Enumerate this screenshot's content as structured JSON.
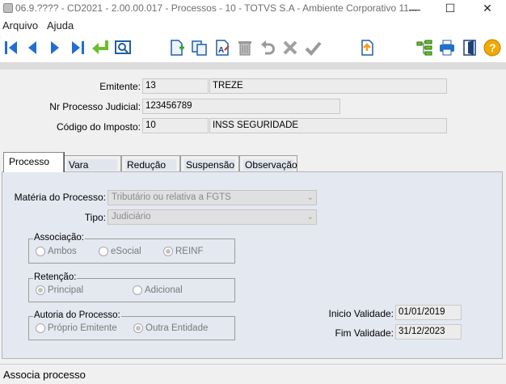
{
  "window": {
    "title": "06.9.???? - CD2021 - 2.00.00.017 - Processos - 10 - TOTVS S.A - Ambiente Corporativo 11...",
    "minimize_glyph": "—",
    "maximize_glyph": "☐",
    "close_glyph": "✕"
  },
  "menu": {
    "items": [
      "Arquivo",
      "Ajuda"
    ]
  },
  "toolbar": {
    "icons": [
      "first-record-icon",
      "previous-record-icon",
      "next-record-icon",
      "last-record-icon",
      "return-icon",
      "search-icon",
      "new-record-icon",
      "copy-icon",
      "edit-icon",
      "delete-icon",
      "undo-icon",
      "cancel-icon",
      "confirm-icon",
      "export-icon",
      "hierarchy-icon",
      "print-icon",
      "exit-icon",
      "help-icon"
    ]
  },
  "header": {
    "emitente": {
      "label": "Emitente:",
      "code": "13",
      "name": "TREZE"
    },
    "nr_processo": {
      "label": "Nr Processo Judicial:",
      "value": "123456789"
    },
    "imposto": {
      "label": "Código do Imposto:",
      "code": "10",
      "name": "INSS SEGURIDADE"
    }
  },
  "tabs": [
    {
      "label": "Processo",
      "active": true
    },
    {
      "label": "Vara",
      "active": false
    },
    {
      "label": "Redução",
      "active": false
    },
    {
      "label": "Suspensão",
      "active": false
    },
    {
      "label": "Observação",
      "active": false
    }
  ],
  "processo": {
    "materia": {
      "label": "Matéria do Processo:",
      "value": "Tributário ou relativa a FGTS"
    },
    "tipo": {
      "label": "Tipo:",
      "value": "Judiciário"
    },
    "associacao": {
      "title": "Associação:",
      "options": [
        "Ambos",
        "eSocial",
        "REINF"
      ],
      "selected": "REINF"
    },
    "retencao": {
      "title": "Retenção:",
      "options": [
        "Principal",
        "Adicional"
      ],
      "selected": "Principal"
    },
    "autoria": {
      "title": "Autoria do Processo:",
      "options": [
        "Próprio Emitente",
        "Outra Entidade"
      ],
      "selected": "Outra Entidade"
    },
    "inicio_validade": {
      "label": "Inicio Validade:",
      "value": "01/01/2019"
    },
    "fim_validade": {
      "label": "Fim Validade:",
      "value": "31/12/2023"
    }
  },
  "status": {
    "text": "Associa processo"
  },
  "colors": {
    "panel": "#e4e8f0",
    "toolbar_blue": "#1f6fd1",
    "inactive_tab": "#e1e5ee"
  }
}
